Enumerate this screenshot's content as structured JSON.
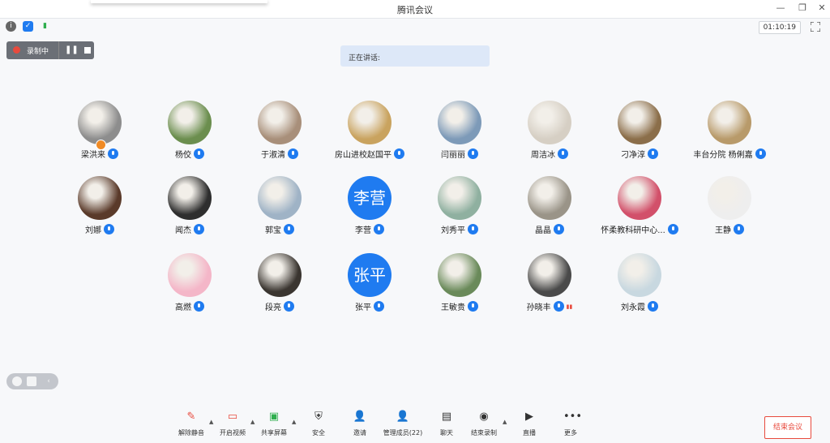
{
  "window": {
    "title": "腾讯会议",
    "timer": "01:10:19"
  },
  "recording": {
    "label": "录制中"
  },
  "speaking": {
    "label": "正在讲话:"
  },
  "participants": [
    {
      "name": "梁洪来",
      "initials": "",
      "host": true
    },
    {
      "name": "杨佼",
      "initials": ""
    },
    {
      "name": "于淑清",
      "initials": ""
    },
    {
      "name": "房山进校赵国平",
      "initials": ""
    },
    {
      "name": "闫丽丽",
      "initials": ""
    },
    {
      "name": "周洁冰",
      "initials": ""
    },
    {
      "name": "刁净淳",
      "initials": ""
    },
    {
      "name": "丰台分院 杨俐嘉",
      "initials": ""
    },
    {
      "name": "刘娜",
      "initials": ""
    },
    {
      "name": "闻杰",
      "initials": ""
    },
    {
      "name": "郭宝",
      "initials": ""
    },
    {
      "name": "李营",
      "initials": "李营"
    },
    {
      "name": "刘秀平",
      "initials": ""
    },
    {
      "name": "晶晶",
      "initials": ""
    },
    {
      "name": "怀柔教科研中心...",
      "initials": ""
    },
    {
      "name": "王静",
      "initials": ""
    },
    {
      "name": "高燃",
      "initials": ""
    },
    {
      "name": "段亮",
      "initials": ""
    },
    {
      "name": "张平",
      "initials": "张平"
    },
    {
      "name": "王敏贵",
      "initials": ""
    },
    {
      "name": "孙晓丰",
      "initials": ""
    },
    {
      "name": "刘永霞",
      "initials": ""
    }
  ],
  "toolbar": {
    "unmute": "解除静音",
    "video": "开启视频",
    "share": "共享屏幕",
    "security": "安全",
    "invite": "邀请",
    "members": "管理成员(22)",
    "chat": "聊天",
    "stop_record": "结束录制",
    "live": "直播",
    "more": "更多"
  },
  "end_meeting": "结束会议",
  "colors": {
    "accent": "#1f7bf0",
    "danger": "#e84a3d"
  }
}
